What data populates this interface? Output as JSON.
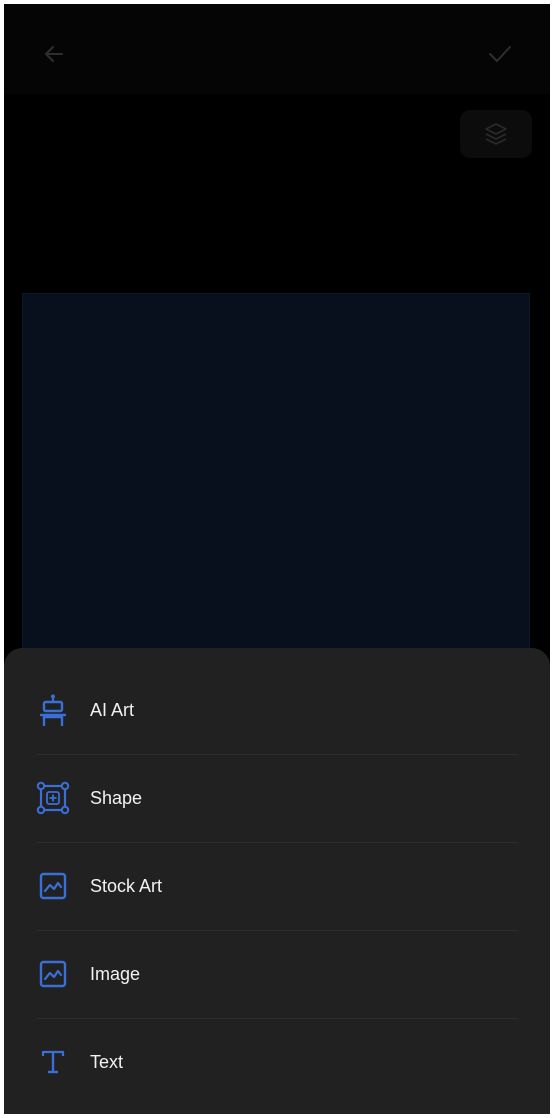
{
  "header": {
    "back_icon": "arrow-left-icon",
    "confirm_icon": "checkmark-icon"
  },
  "toolbar": {
    "layers_icon": "layers-icon"
  },
  "canvas": {
    "background_color": "#08101d"
  },
  "add_menu": {
    "accent_color": "#3b6fd8",
    "items": [
      {
        "label": "AI Art",
        "icon": "robot-icon"
      },
      {
        "label": "Shape",
        "icon": "shape-icon"
      },
      {
        "label": "Stock Art",
        "icon": "image-icon"
      },
      {
        "label": "Image",
        "icon": "image-icon"
      },
      {
        "label": "Text",
        "icon": "text-icon"
      }
    ]
  }
}
